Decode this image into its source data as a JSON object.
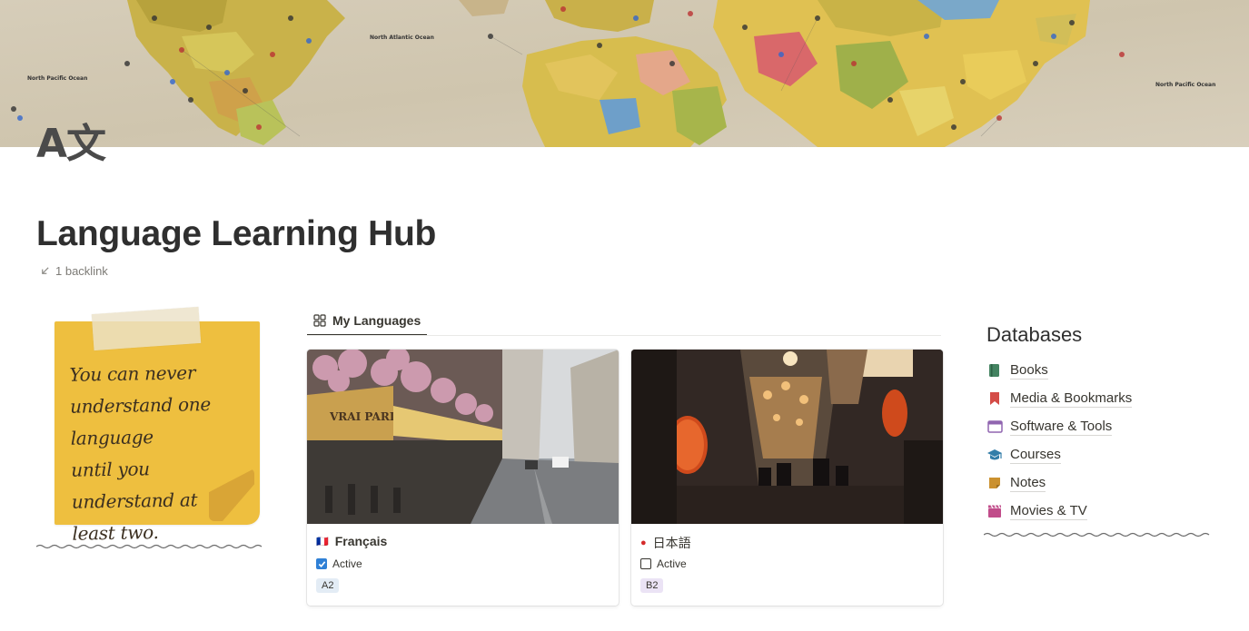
{
  "page": {
    "icon_text": "A文",
    "title": "Language Learning Hub",
    "backlink_label": "1 backlink"
  },
  "cover": {
    "description": "World map with pins",
    "ocean_labels": [
      "North Atlantic Ocean",
      "North Pacific Ocean",
      "North Pacific Ocean"
    ]
  },
  "quote": {
    "lines": [
      "You can never",
      "understand one language",
      "until you understand at",
      "least two."
    ]
  },
  "gallery": {
    "view_label": "My Languages",
    "cards": [
      {
        "flag": "🇫🇷",
        "title": "Français",
        "active_label": "Active",
        "active": true,
        "level": "A2",
        "level_color": "#e3ecf5",
        "sign_text": "VRAI PARIS"
      },
      {
        "flag": "●",
        "flag_color": "#d42a2a",
        "title": "日本語",
        "active_label": "Active",
        "active": false,
        "level": "B2",
        "level_color": "#ebe3f5"
      }
    ]
  },
  "databases": {
    "heading": "Databases",
    "items": [
      {
        "icon": "book-icon",
        "label": "Books",
        "color": "#448361"
      },
      {
        "icon": "bookmark-icon",
        "label": "Media & Bookmarks",
        "color": "#d44c47"
      },
      {
        "icon": "browser-window-icon",
        "label": "Software & Tools",
        "color": "#9065b0"
      },
      {
        "icon": "graduation-cap-icon",
        "label": "Courses",
        "color": "#337ea9"
      },
      {
        "icon": "note-icon",
        "label": "Notes",
        "color": "#cb912f"
      },
      {
        "icon": "clapperboard-icon",
        "label": "Movies & TV",
        "color": "#c14c8a"
      }
    ]
  },
  "colors": {
    "text": "#37352f",
    "note_yellow": "#eebf3f",
    "checkbox_blue": "#2f80d6"
  }
}
